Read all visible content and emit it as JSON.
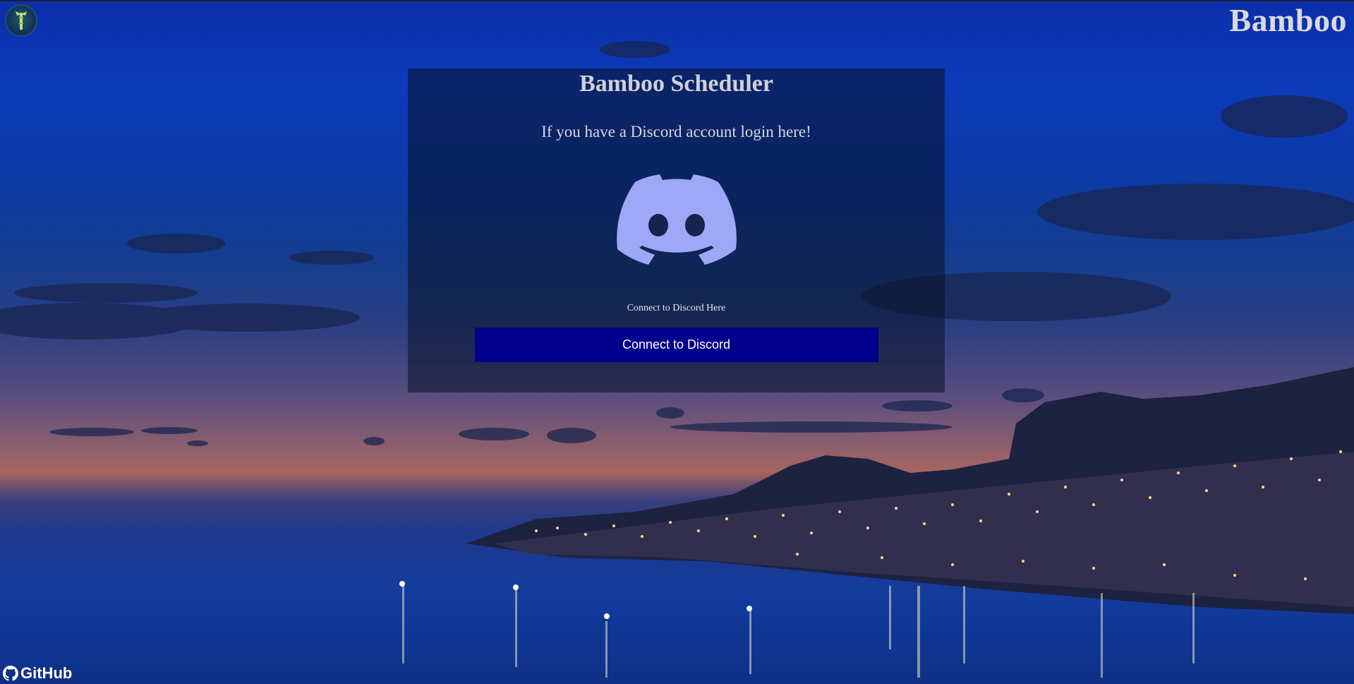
{
  "brand": {
    "title": "Bamboo",
    "logo_icon": "bamboo-logo-icon"
  },
  "login_panel": {
    "title": "Bamboo Scheduler",
    "subtitle": "If you have a Discord account login here!",
    "logo_icon": "discord-logo-icon",
    "connect_label": "Connect to Discord Here",
    "connect_button_label": "Connect to Discord"
  },
  "footer": {
    "github_label": "GitHub",
    "github_icon": "github-icon"
  },
  "colors": {
    "discord_blurple": "#9fa8f7",
    "button_background": "#00008b",
    "panel_overlay": "rgba(10, 18, 40, 0.55)"
  }
}
